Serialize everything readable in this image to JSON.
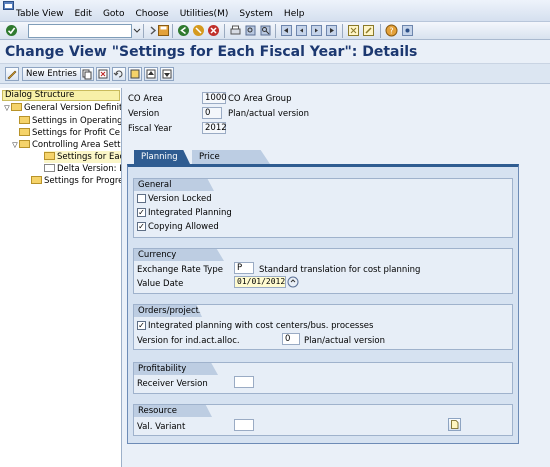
{
  "menu": [
    "Table View",
    "Edit",
    "Goto",
    "Choose",
    "Utilities(M)",
    "System",
    "Help"
  ],
  "title": "Change View \"Settings for Each Fiscal Year\": Details",
  "toolbar": {
    "new_entries": "New Entries"
  },
  "dialog": {
    "header": "Dialog Structure",
    "items": [
      {
        "label": "General Version Definitic",
        "level": 0,
        "toggle": "▽",
        "selected": false
      },
      {
        "label": "Settings in Operating",
        "level": 1,
        "toggle": "",
        "selected": false
      },
      {
        "label": "Settings for Profit Ce",
        "level": 1,
        "toggle": "",
        "selected": false
      },
      {
        "label": "Controlling Area Setti",
        "level": 1,
        "toggle": "▽",
        "selected": false
      },
      {
        "label": "Settings for Each",
        "level": 2,
        "toggle": "",
        "selected": true
      },
      {
        "label": "Delta Version: Bu",
        "level": 2,
        "toggle": "",
        "selected": false
      },
      {
        "label": "Settings for Progress",
        "level": 1,
        "toggle": "",
        "selected": false
      }
    ]
  },
  "header_fields": {
    "co_area_label": "CO Area",
    "co_area_value": "1000",
    "co_area_desc": "CO Area Group",
    "version_label": "Version",
    "version_value": "0",
    "version_desc": "Plan/actual version",
    "fiscal_year_label": "Fiscal Year",
    "fiscal_year_value": "2012"
  },
  "tabs": {
    "planning": "Planning",
    "price": "Price calculation"
  },
  "general": {
    "title": "General indicators",
    "version_locked": "Version Locked",
    "integrated_planning": "Integrated Planning",
    "copying_allowed": "Copying Allowed"
  },
  "currency": {
    "title": "Currency translation",
    "rate_label": "Exchange Rate Type",
    "rate_value": "P",
    "rate_desc": "Standard translation for cost planning",
    "date_label": "Value Date",
    "date_value": "01/01/2012"
  },
  "orders": {
    "title": "Orders/projects",
    "integrated": "Integrated planning with cost centers/bus. processes",
    "version_label": "Version for ind.act.alloc.",
    "version_value": "0",
    "version_desc": "Plan/actual version"
  },
  "profitability": {
    "title": "Profitability Analysis",
    "receiver_label": "Receiver Version"
  },
  "resource": {
    "title": "Resource planning",
    "variant_label": "Val. Variant"
  }
}
